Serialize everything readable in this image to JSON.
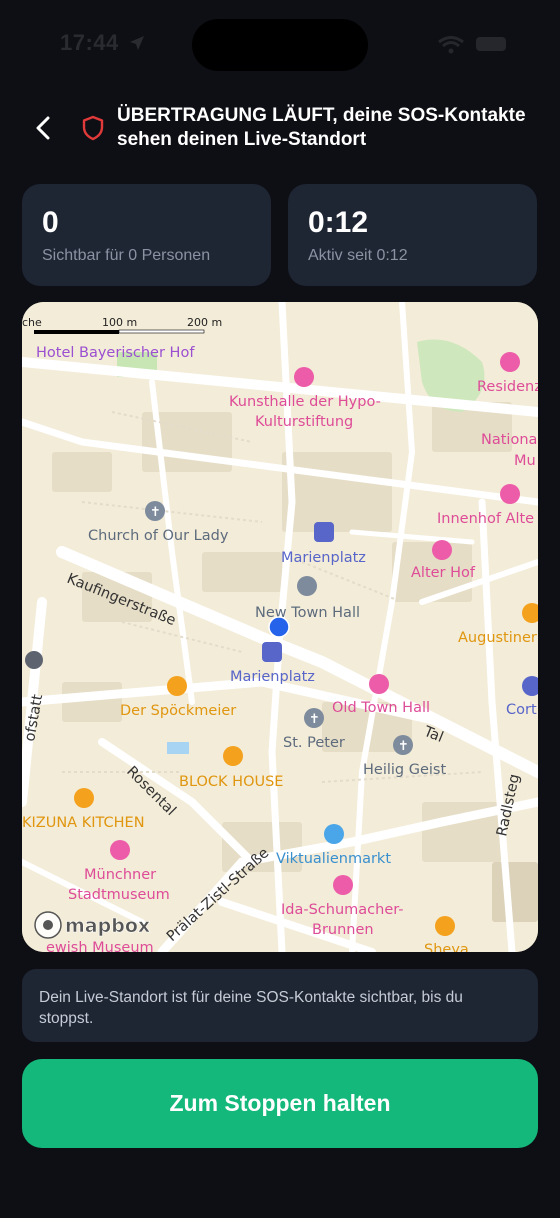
{
  "status": {
    "time": "17:44"
  },
  "header": {
    "title_line1": "ÜBERTRAGUNG LÄUFT, deine SOS-Kontakte",
    "title_line2": "sehen deinen Live-Standort"
  },
  "stats": {
    "viewers": {
      "value": "0",
      "label": "Sichtbar für 0 Personen"
    },
    "duration": {
      "value": "0:12",
      "label": "Aktiv seit 0:12"
    }
  },
  "map": {
    "scale": {
      "label_100": "100 m",
      "label_200": "200 m"
    },
    "corner_label": "che",
    "attribution": "mapbox",
    "labels": {
      "hotel": "Hotel Bayerischer Hof",
      "kunsthalle_1": "Kunsthalle der Hypo-",
      "kunsthalle_2": "Kulturstiftung",
      "residenz": "Residenz",
      "national_1": "Nationa",
      "national_2": "Mu",
      "church": "Church of Our Lady",
      "innenhof": "Innenhof Alte",
      "marienplatz_station": "Marienplatz",
      "alter_hof": "Alter Hof",
      "kaufinger": "Kaufingerstraße",
      "new_town_hall": "New Town Hall",
      "augustiner": "Augustiner",
      "marienplatz": "Marienplatz",
      "corti": "Cort",
      "hofstatt": "ofstatt",
      "spoeckmeier": "Der Spöckmeier",
      "old_town_hall": "Old Town Hall",
      "tal": "Tal",
      "st_peter": "St. Peter",
      "heilig_geist": "Heilig Geist",
      "rosental": "Rosental",
      "block_house": "BLOCK HOUSE",
      "radlsteg": "Radlsteg",
      "kizuna": "KIZUNA KITCHEN",
      "viktualienmarkt": "Viktualienmarkt",
      "stadtmuseum_1": "Münchner",
      "stadtmuseum_2": "Stadtmuseum",
      "zistl": "Prälat-Zistl-Straße",
      "ida_1": "Ida-Schumacher-",
      "ida_2": "Brunnen",
      "jewish_museum": "ewish Museum",
      "sheya": "Sheya"
    }
  },
  "info": {
    "text": "Dein Live-Standort ist für deine SOS-Kontakte sichtbar, bis du stoppst."
  },
  "stop_button": {
    "label": "Zum Stoppen halten"
  },
  "colors": {
    "accent_green": "#14b87a",
    "shield_red": "#e03a3a",
    "user_location": "#2563eb"
  }
}
